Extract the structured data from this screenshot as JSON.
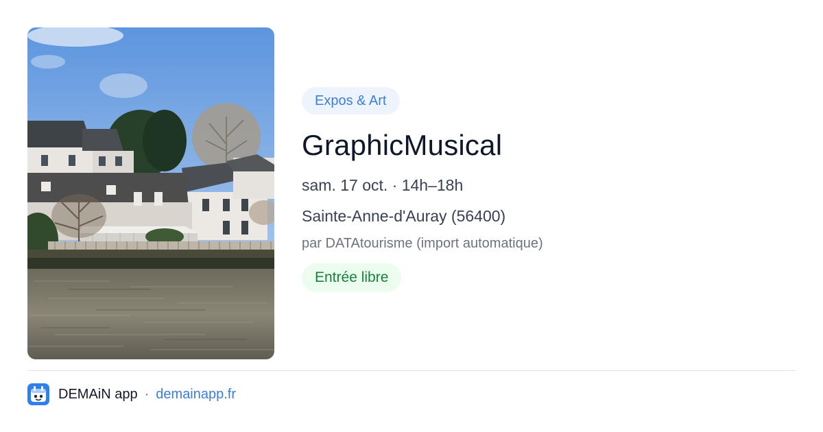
{
  "event": {
    "category": "Expos & Art",
    "title": "GraphicMusical",
    "datetime": "sam. 17 oct. · 14h–18h",
    "location": "Sainte-Anne-d'Auray (56400)",
    "source": "par DATAtourisme (import automatique)",
    "price": "Entrée libre"
  },
  "footer": {
    "app_name": "DEMAiN app",
    "separator": "·",
    "link": "demainapp.fr"
  },
  "colors": {
    "accent_blue": "#3b7dd8",
    "green": "#15803d"
  }
}
